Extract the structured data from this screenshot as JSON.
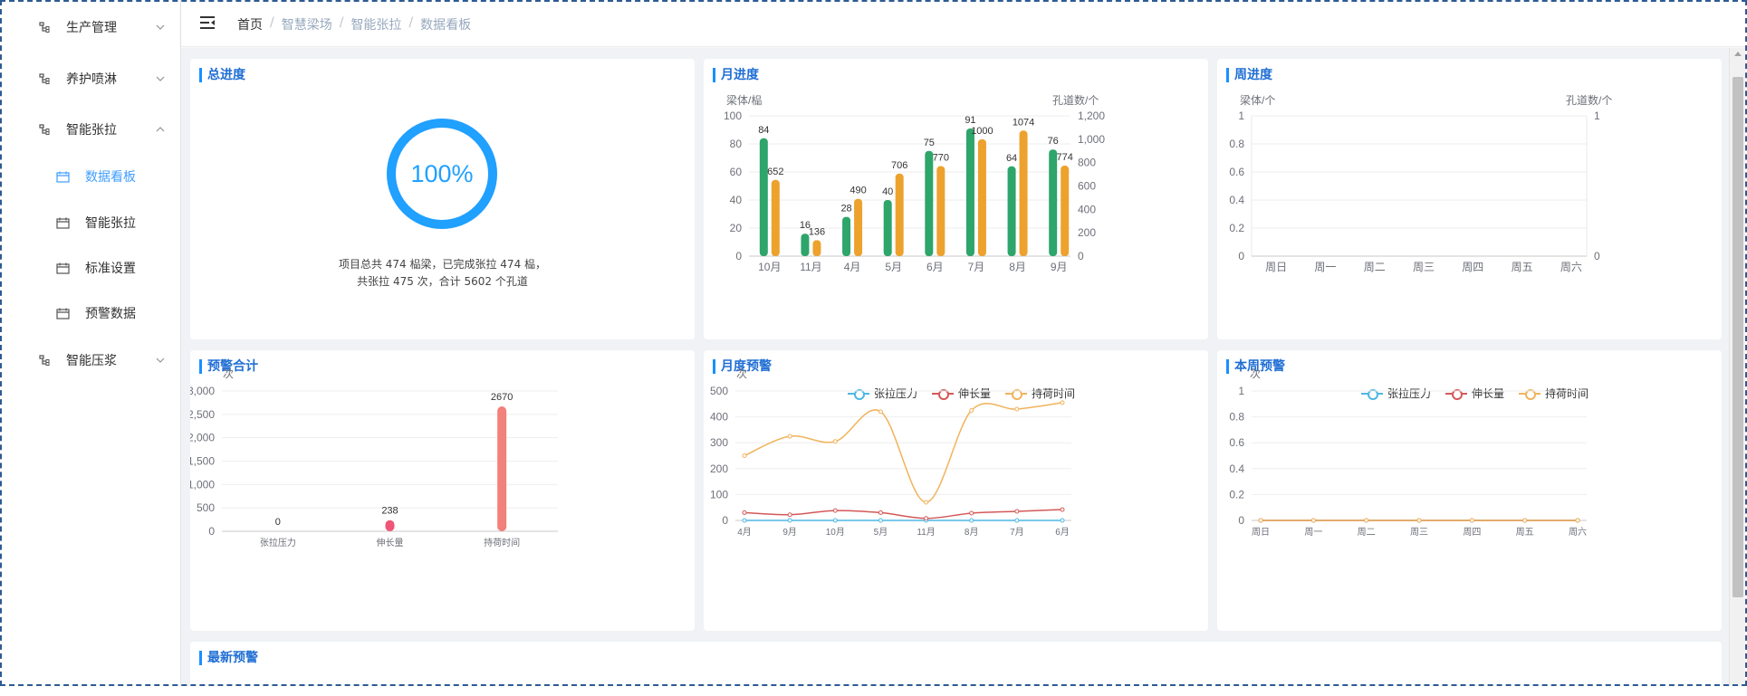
{
  "sidebar": {
    "items": [
      {
        "label": "生产管理",
        "expanded": false
      },
      {
        "label": "养护喷淋",
        "expanded": false
      },
      {
        "label": "智能张拉",
        "expanded": true
      },
      {
        "label": "智能压浆",
        "expanded": false
      }
    ],
    "sub_items": [
      {
        "label": "数据看板",
        "active": true
      },
      {
        "label": "智能张拉",
        "active": false
      },
      {
        "label": "标准设置",
        "active": false
      },
      {
        "label": "预警数据",
        "active": false
      }
    ]
  },
  "breadcrumb": [
    "首页",
    "智慧梁场",
    "智能张拉",
    "数据看板"
  ],
  "total_progress": {
    "title": "总进度",
    "percent_label": "100%",
    "percent": 100,
    "line1": "项目总共 474 榀梁，已完成张拉 474 榀，",
    "line2": "共张拉 475 次，合计 5602 个孔道"
  },
  "colors": {
    "accent": "#1890ff",
    "green": "#2ea56a",
    "orange": "#eda22e",
    "red_bar": "#f2807b",
    "pink_bar": "#ef5577",
    "line_blue": "#4fb7e3",
    "line_red": "#d45858",
    "line_yellow": "#f0b35b"
  },
  "chart_data": [
    {
      "title": "月进度",
      "type": "bar",
      "ylabel": "梁体/榀",
      "y2label": "孔道数/个",
      "categories": [
        "10月",
        "11月",
        "4月",
        "5月",
        "6月",
        "7月",
        "8月",
        "9月"
      ],
      "ylim": [
        0,
        100
      ],
      "y2lim": [
        0,
        1200
      ],
      "yticks": [
        "0",
        "20",
        "40",
        "60",
        "80",
        "100"
      ],
      "y2ticks": [
        "0",
        "200",
        "400",
        "600",
        "800",
        "1,000",
        "1,200"
      ],
      "series": [
        {
          "name": "梁体",
          "axis": "left",
          "values": [
            84,
            16,
            28,
            40,
            75,
            91,
            64,
            76
          ]
        },
        {
          "name": "孔道数",
          "axis": "right",
          "values": [
            652,
            136,
            490,
            706,
            770,
            1000,
            1074,
            774
          ]
        }
      ]
    },
    {
      "title": "周进度",
      "type": "bar",
      "ylabel": "梁体/个",
      "y2label": "孔道数/个",
      "categories": [
        "周日",
        "周一",
        "周二",
        "周三",
        "周四",
        "周五",
        "周六"
      ],
      "ylim": [
        0,
        1
      ],
      "yticks": [
        "0",
        "0.2",
        "0.4",
        "0.6",
        "0.8",
        "1"
      ],
      "y2ticks": [
        "0",
        "1"
      ],
      "series": []
    },
    {
      "title": "预警合计",
      "type": "bar",
      "ylabel": "次",
      "categories": [
        "张拉压力",
        "伸长量",
        "持荷时间"
      ],
      "values": [
        0,
        238,
        2670
      ],
      "ylim": [
        0,
        3000
      ],
      "yticks": [
        "0",
        "500",
        "1,000",
        "1,500",
        "2,000",
        "2,500",
        "3,000"
      ]
    },
    {
      "title": "月度预警",
      "type": "line",
      "ylabel": "次",
      "categories": [
        "4月",
        "9月",
        "10月",
        "5月",
        "11月",
        "8月",
        "7月",
        "6月"
      ],
      "ylim": [
        0,
        500
      ],
      "yticks": [
        "0",
        "100",
        "200",
        "300",
        "400",
        "500"
      ],
      "series": [
        {
          "name": "张拉压力",
          "values": [
            0,
            0,
            0,
            0,
            0,
            0,
            0,
            0
          ]
        },
        {
          "name": "伸长量",
          "values": [
            30,
            22,
            38,
            30,
            8,
            28,
            35,
            42
          ]
        },
        {
          "name": "持荷时间",
          "values": [
            250,
            325,
            305,
            420,
            70,
            425,
            430,
            455
          ]
        }
      ]
    },
    {
      "title": "本周预警",
      "type": "line",
      "ylabel": "次",
      "categories": [
        "周日",
        "周一",
        "周二",
        "周三",
        "周四",
        "周五",
        "周六"
      ],
      "ylim": [
        0,
        1
      ],
      "yticks": [
        "0",
        "0.2",
        "0.4",
        "0.6",
        "0.8",
        "1"
      ],
      "series": [
        {
          "name": "张拉压力",
          "values": [
            0,
            0,
            0,
            0,
            0,
            0,
            0
          ]
        },
        {
          "name": "伸长量",
          "values": [
            0,
            0,
            0,
            0,
            0,
            0,
            0
          ]
        },
        {
          "name": "持荷时间",
          "values": [
            0,
            0,
            0,
            0,
            0,
            0,
            0
          ]
        }
      ]
    }
  ],
  "latest_warning": {
    "title": "最新预警"
  }
}
